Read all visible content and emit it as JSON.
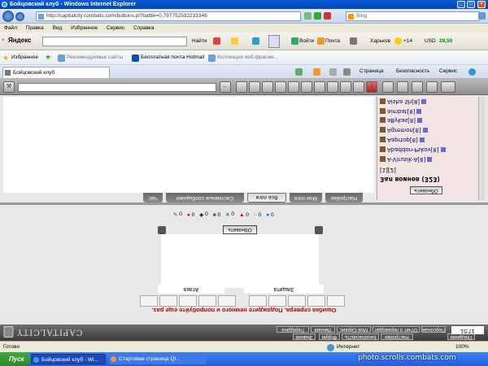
{
  "window": {
    "title": "Бойцовский клуб - Windows Internet Explorer"
  },
  "address": {
    "url": "http://capitalcity.combats.com/buttons.pl?battle=0.797752532233346",
    "search_placeholder": "Bing"
  },
  "menu": [
    "Файл",
    "Правка",
    "Вид",
    "Избранное",
    "Сервис",
    "Справка"
  ],
  "yandex": {
    "logo": "Яндекс",
    "find": "Найти",
    "login": "Войти",
    "mail": "Почта",
    "city": "Харьков",
    "temp": "+14",
    "currency": "USD",
    "rate": "29,50"
  },
  "favorites": {
    "label": "Избранное",
    "items": [
      "Рекомендуемые сайты",
      "Бесплатная почта Hotmail",
      "Коллекция веб-фрагме..."
    ]
  },
  "tabs": {
    "active": "Бойцовский клуб",
    "tools": [
      "Страница",
      "Безопасность",
      "Сервис"
    ]
  },
  "chat": {
    "tabs": [
      "Чат",
      "Системные сообщения",
      "Все логи",
      "Мои логи",
      "Настройки"
    ],
    "active_tab": "Все логи"
  },
  "userlist": {
    "title": "Зал воинов (323)",
    "refresh": "Обновить",
    "pager": "[1][2]",
    "users": [
      "A-Virusik-A[8]",
      "Abaddon-Pskov[8]",
      "Aaprtop[8]",
      "Agremon[8]",
      "aBykas[8]",
      "aimbat[8]",
      "Aisha Sh[8]"
    ]
  },
  "battle": {
    "stats": [
      "0",
      "0",
      "0",
      "0",
      "0",
      "0",
      "0",
      "0"
    ],
    "refresh": "Обновить",
    "attack": "Атака",
    "defense": "Защита",
    "error": "Ошибка сервера. Подождите немного и попробуйте еще раз."
  },
  "footer": {
    "logo": "CAPITALCITY",
    "clock": "17:51",
    "buttons": [
      "Передача",
      "Умения",
      "Мой Сервис",
      "Отчет о переводах",
      "Персонаж",
      "Поединки"
    ],
    "buttons2": [
      "Знания",
      "Форум",
      "Безопасность",
      "Настройки"
    ]
  },
  "status": {
    "left": "Готово",
    "zone": "Интернет",
    "zoom": "100%"
  },
  "taskbar": {
    "start": "Пуск",
    "tasks": [
      "Бойцовский клуб - Wi...",
      "Стартовая страница QI..."
    ]
  },
  "watermark": "photo.scrolls.combats.com",
  "colors": {
    "error": "#c00000",
    "userlist_bg": "#f3e4e4",
    "taskbar": "#245edc"
  }
}
